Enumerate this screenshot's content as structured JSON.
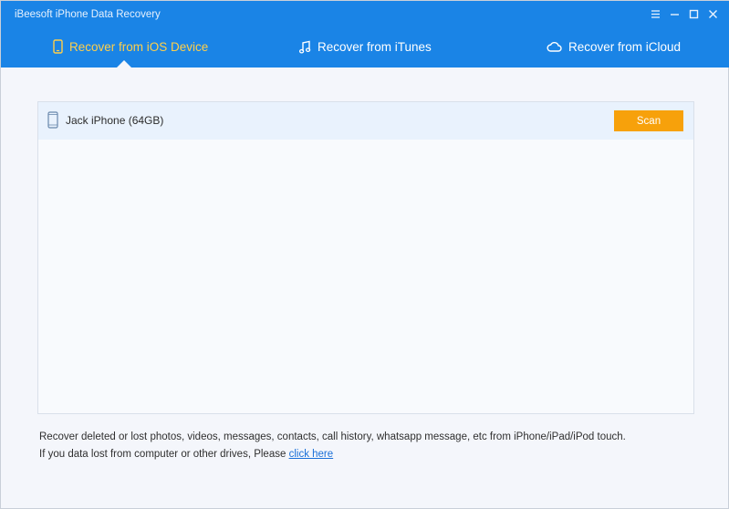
{
  "window": {
    "title": "iBeesoft iPhone Data Recovery",
    "controls": {
      "menu_icon": "menu-icon",
      "minimize_icon": "minimize-icon",
      "maximize_icon": "maximize-icon",
      "close_icon": "close-icon"
    }
  },
  "tabs": [
    {
      "label": "Recover from iOS Device",
      "icon": "phone-icon",
      "active": true
    },
    {
      "label": "Recover from iTunes",
      "icon": "music-note-icon",
      "active": false
    },
    {
      "label": "Recover from iCloud",
      "icon": "cloud-icon",
      "active": false
    }
  ],
  "device": {
    "name": "Jack iPhone (64GB)",
    "icon": "phone-icon",
    "scan_label": "Scan"
  },
  "footer": {
    "line1": "Recover deleted or lost photos, videos, messages, contacts, call history, whatsapp message, etc from iPhone/iPad/iPod touch.",
    "line2_prefix": "If you data lost from computer or other drives, Please ",
    "link_text": "click here"
  },
  "colors": {
    "header": "#1a84e6",
    "active_tab": "#ffcf4a",
    "scan_button": "#f7a10b",
    "link": "#1a6fd8"
  }
}
